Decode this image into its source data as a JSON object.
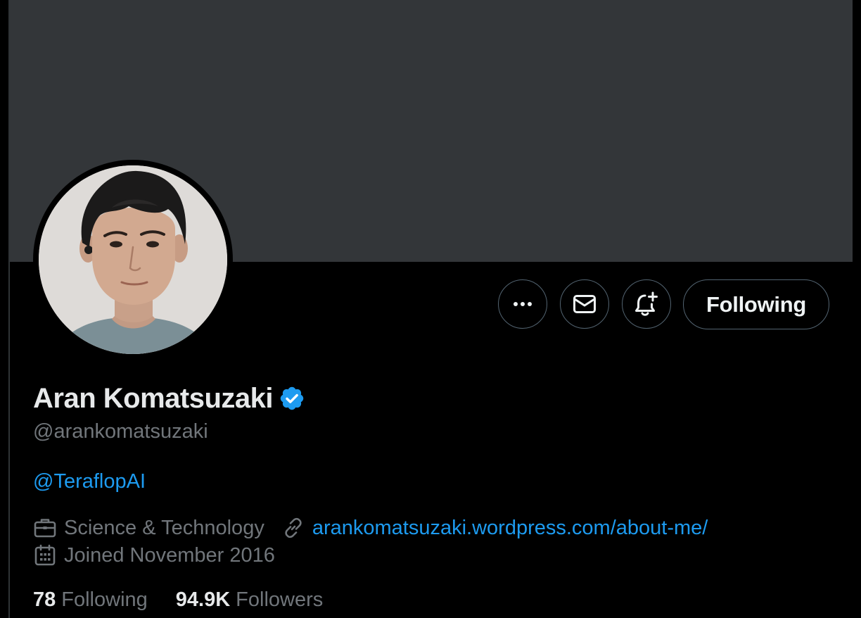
{
  "profile": {
    "display_name": "Aran Komatsuzaki",
    "verified": true,
    "handle": "@arankomatsuzaki",
    "bio_mention": "@TeraflopAI",
    "category": "Science & Technology",
    "website": "arankomatsuzaki.wordpress.com/about-me/",
    "joined": "Joined November 2016"
  },
  "stats": {
    "following_count": "78",
    "following_label": "Following",
    "followers_count": "94.9K",
    "followers_label": "Followers"
  },
  "actions": {
    "more_icon": "more-horizontal-icon",
    "message_icon": "envelope-icon",
    "notify_icon": "bell-plus-icon",
    "follow_label": "Following"
  },
  "icons": {
    "category": "briefcase-icon",
    "website": "link-icon",
    "joined": "calendar-icon",
    "verified": "verified-badge-icon"
  },
  "colors": {
    "background": "#000000",
    "banner": "#333639",
    "accent": "#1d9bf0",
    "verified": "#1d9bf0",
    "secondary_text": "#71767b",
    "primary_text": "#e7e9ea",
    "button_border": "#536471"
  }
}
